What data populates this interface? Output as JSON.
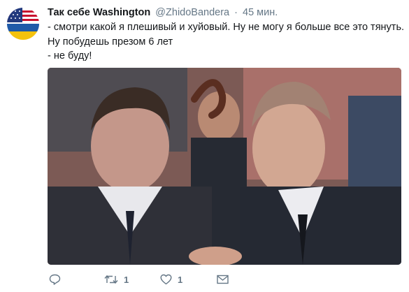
{
  "tweet": {
    "author_name": "Так себе Washington",
    "author_handle": "@ZhidoBandera",
    "separator": "·",
    "time": "45 мин.",
    "text_lines": [
      "- смотри какой я плешивый и хуйовый. Ну не могу я больше все это тянуть.",
      "Ну побудешь презом 6 лет",
      "- не буду!"
    ]
  },
  "actions": {
    "reply_icon": "reply-icon",
    "retweet_icon": "retweet-icon",
    "retweet_count": "1",
    "like_icon": "heart-icon",
    "like_count": "1",
    "message_icon": "envelope-icon"
  },
  "colors": {
    "text": "#14171a",
    "secondary": "#657786",
    "avatar_blue": "#1f5aa8",
    "avatar_yellow": "#f4c20d",
    "avatar_red": "#c8102e"
  }
}
